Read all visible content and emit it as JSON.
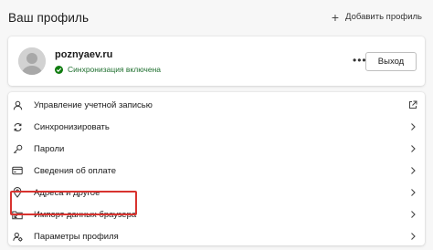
{
  "header": {
    "title": "Ваш профиль",
    "add_profile_label": "Добавить профиль"
  },
  "profile": {
    "name": "poznyaev.ru",
    "sync_status": "Синхронизация включена",
    "more_label": "•••",
    "logout_label": "Выход"
  },
  "menu": {
    "items": [
      {
        "label": "Управление учетной записью",
        "icon": "account-icon",
        "end_icon": "external-link-icon"
      },
      {
        "label": "Синхронизировать",
        "icon": "sync-icon",
        "end_icon": "chevron-right-icon"
      },
      {
        "label": "Пароли",
        "icon": "key-icon",
        "end_icon": "chevron-right-icon"
      },
      {
        "label": "Сведения об оплате",
        "icon": "card-icon",
        "end_icon": "chevron-right-icon"
      },
      {
        "label": "Адреса и другое",
        "icon": "location-icon",
        "end_icon": "chevron-right-icon"
      },
      {
        "label": "Импорт данных браузера",
        "icon": "import-icon",
        "end_icon": "chevron-right-icon"
      },
      {
        "label": "Параметры профиля",
        "icon": "profile-settings-icon",
        "end_icon": "chevron-right-icon"
      }
    ]
  },
  "colors": {
    "highlight": "#d8332f",
    "sync_green": "#107c10",
    "background": "#f7f7f7"
  }
}
